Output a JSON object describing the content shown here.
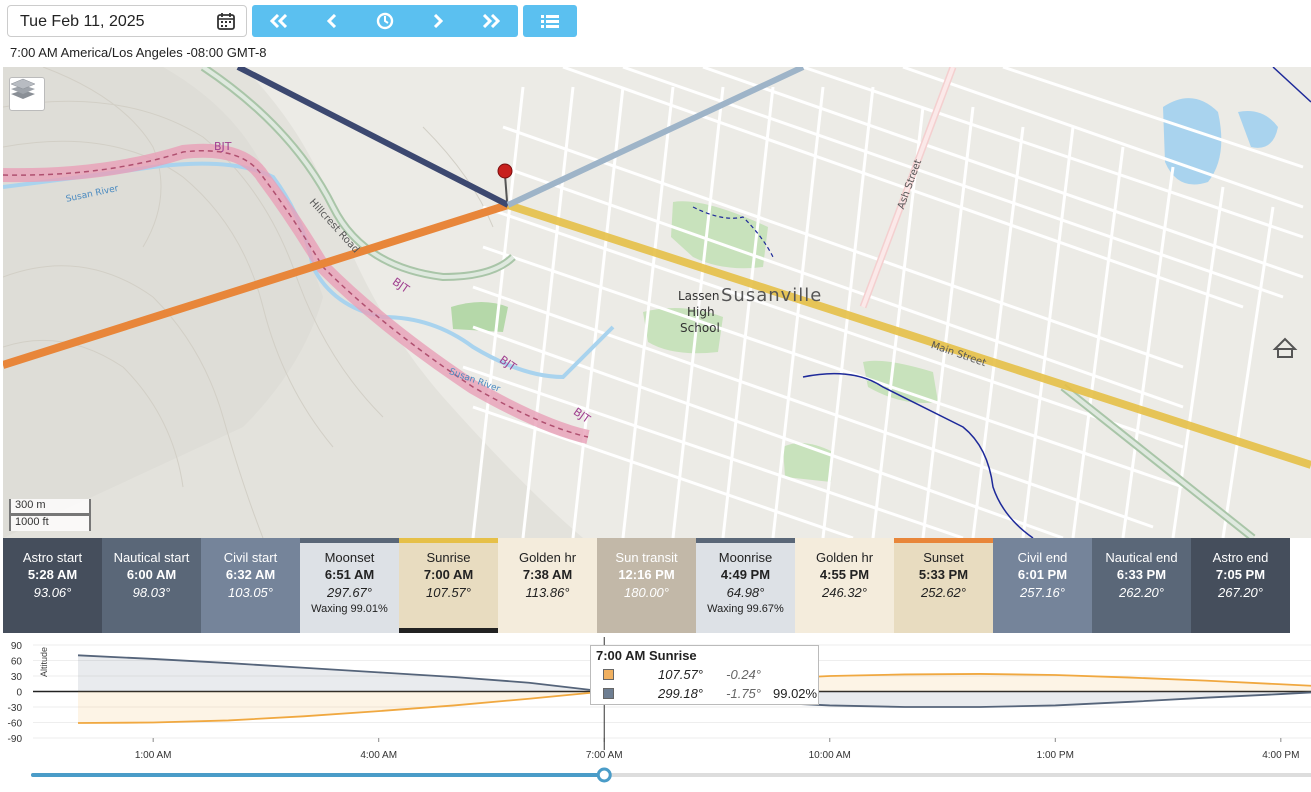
{
  "header": {
    "date": "Tue Feb 11, 2025",
    "timezone": "7:00 AM America/Los Angeles -08:00 GMT-8",
    "icons": [
      "calendar-icon",
      "double-left-icon",
      "left-icon",
      "clock-icon",
      "right-icon",
      "double-right-icon",
      "list-icon"
    ]
  },
  "map": {
    "town": "Susanville",
    "school": [
      "Lassen",
      "High",
      "School"
    ],
    "roads": [
      "Hillcrest Road",
      "Ash Street",
      "Main Street"
    ],
    "river": "Susan River",
    "trail": "BJT",
    "scale": [
      "300 m",
      "1000 ft"
    ]
  },
  "events": [
    {
      "name": "Astro start",
      "time": "5:28 AM",
      "deg": "93.06°",
      "style": "dark1"
    },
    {
      "name": "Nautical start",
      "time": "6:00 AM",
      "deg": "98.03°",
      "style": "dark2"
    },
    {
      "name": "Civil start",
      "time": "6:32 AM",
      "deg": "103.05°",
      "style": "dark3"
    },
    {
      "name": "Moonset",
      "time": "6:51 AM",
      "deg": "297.67°",
      "phase": "Waxing 99.01%",
      "style": "moon"
    },
    {
      "name": "Sunrise",
      "time": "7:00 AM",
      "deg": "107.57°",
      "style": "sunr"
    },
    {
      "name": "Golden hr",
      "time": "7:38 AM",
      "deg": "113.86°",
      "style": "gold"
    },
    {
      "name": "Sun transit",
      "time": "12:16 PM",
      "deg": "180.00°",
      "style": "transit"
    },
    {
      "name": "Moonrise",
      "time": "4:49 PM",
      "deg": "64.98°",
      "phase": "Waxing 99.67%",
      "style": "moon"
    },
    {
      "name": "Golden hr",
      "time": "4:55 PM",
      "deg": "246.32°",
      "style": "gold"
    },
    {
      "name": "Sunset",
      "time": "5:33 PM",
      "deg": "252.62°",
      "style": "sunr"
    },
    {
      "name": "Civil end",
      "time": "6:01 PM",
      "deg": "257.16°",
      "style": "dark3"
    },
    {
      "name": "Nautical end",
      "time": "6:33 PM",
      "deg": "262.20°",
      "style": "dark2"
    },
    {
      "name": "Astro end",
      "time": "7:05 PM",
      "deg": "267.20°",
      "style": "dark1"
    }
  ],
  "tooltip": {
    "title": "7:00 AM Sunrise",
    "sun": {
      "az": "107.57°",
      "alt": "-0.24°",
      "color": "#f0b060"
    },
    "moon": {
      "az": "299.18°",
      "alt": "-1.75°",
      "phase": "99.02%",
      "color": "#6e7e92"
    }
  },
  "chart_data": {
    "type": "area",
    "ylabel": "Altitude",
    "ylim": [
      -90,
      90
    ],
    "y_ticks": [
      "90",
      "60",
      "30",
      "0",
      "-30",
      "-60",
      "-90"
    ],
    "x_hours": [
      0,
      17
    ],
    "x_ticks": [
      "1:00 AM",
      "4:00 AM",
      "7:00 AM",
      "10:00 AM",
      "1:00 PM",
      "4:00 PM"
    ],
    "current_hour": 7,
    "series": [
      {
        "color": "#f0a840",
        "x": [
          0,
          1,
          2,
          3,
          4,
          5,
          6,
          7,
          8,
          9,
          10,
          11,
          12,
          13,
          14,
          15,
          16,
          17
        ],
        "y": [
          -61,
          -60,
          -56,
          -48,
          -38,
          -27,
          -14,
          0,
          13,
          23,
          30,
          33,
          34,
          32,
          27,
          21,
          14,
          7
        ]
      },
      {
        "color": "#55647a",
        "x": [
          0,
          1,
          2,
          3,
          4,
          5,
          6,
          7,
          8,
          9,
          10,
          11,
          12,
          13,
          14,
          15,
          16,
          17
        ],
        "y": [
          70,
          63,
          55,
          46,
          37,
          28,
          17,
          0,
          -10,
          -20,
          -27,
          -30,
          -30,
          -27,
          -20,
          -12,
          -5,
          3
        ]
      }
    ]
  }
}
